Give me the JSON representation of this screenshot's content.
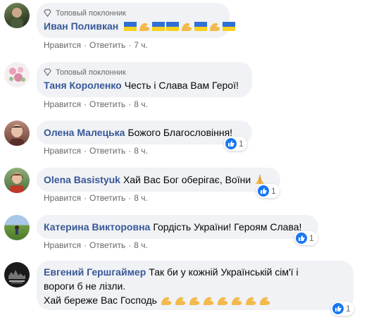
{
  "badge_label": "Топовый поклонник",
  "actions": {
    "like": "Нравится",
    "reply": "Ответить",
    "sep": "·"
  },
  "comments": [
    {
      "author": "Иван Поливкан",
      "text": "",
      "time": "7 ч.",
      "badge": true,
      "reactions": null
    },
    {
      "author": "Таня Короленко",
      "text": "Честь і Слава Вам Герої!",
      "time": "8 ч.",
      "badge": true,
      "reactions": null
    },
    {
      "author": "Олена Малецька",
      "text": "Божого Благословіння!",
      "time": "8 ч.",
      "badge": false,
      "reactions": "1"
    },
    {
      "author": "Olena Basistyuk",
      "text": "Хай Вас Бог оберігає, Воїни",
      "time": "8 ч.",
      "badge": false,
      "reactions": "1"
    },
    {
      "author": "Катерина Викторовна",
      "text": "Гордість України! Героям Слава!",
      "time": "8 ч.",
      "badge": false,
      "reactions": "1"
    },
    {
      "author": "Евгений Гершгаймер",
      "text_line1": "Так би у кожній Українській сім'ї і",
      "text_line2": "вороги б не лізли.",
      "text_line3": "Хай береже Вас Господь",
      "time": "8 ч.",
      "badge": false,
      "reactions": "1"
    }
  ],
  "icons": {
    "like": "thumbs-up-icon",
    "badge": "diamond-icon",
    "flexed_biceps": "flexed-biceps-emoji",
    "flag": "ukraine-flag-emoji",
    "praying_hands": "praying-hands-emoji"
  },
  "colors": {
    "author": "#385898",
    "bubble": "#f0f2f5",
    "meta": "#65676b",
    "like": "#1877f2"
  }
}
